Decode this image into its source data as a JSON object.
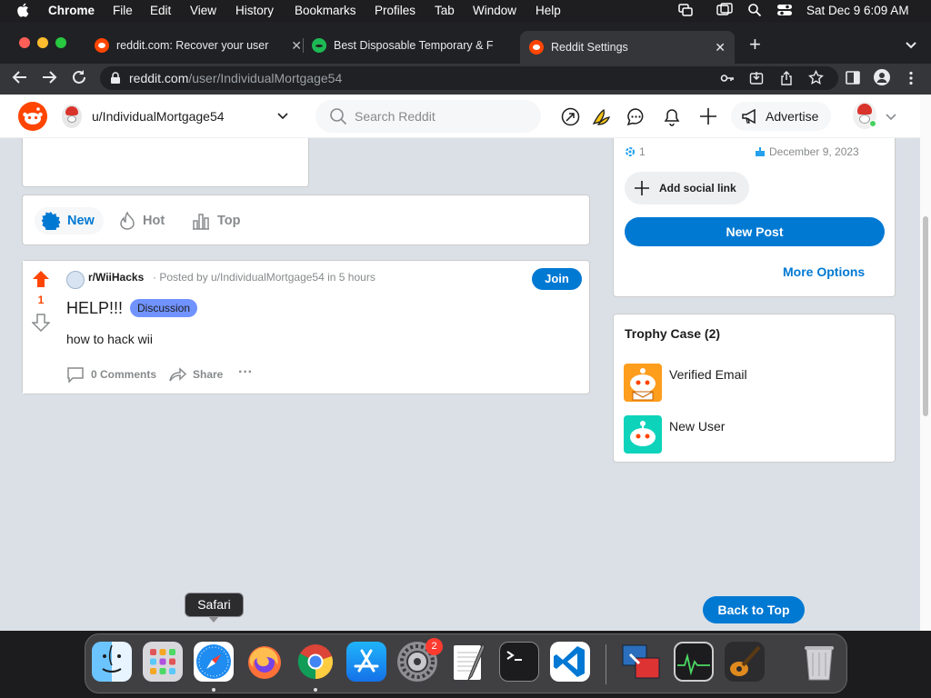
{
  "menubar": {
    "app": "Chrome",
    "items": [
      "File",
      "Edit",
      "View",
      "History",
      "Bookmarks",
      "Profiles",
      "Tab",
      "Window",
      "Help"
    ],
    "datetime": "Sat Dec 9  6:09 AM"
  },
  "tabs": [
    {
      "title": "reddit.com: Recover your user",
      "active": false
    },
    {
      "title": "Best Disposable Temporary & F",
      "active": false
    },
    {
      "title": "Reddit Settings",
      "active": true
    }
  ],
  "address": {
    "domain": "reddit.com",
    "path": "/user/IndividualMortgage54"
  },
  "reddit_header": {
    "community": "u/IndividualMortgage54",
    "search_placeholder": "Search Reddit",
    "advertise": "Advertise"
  },
  "sort_bar": {
    "new": "New",
    "hot": "Hot",
    "top": "Top"
  },
  "post": {
    "votes": "1",
    "subreddit": "r/WiiHacks",
    "posted_by": "· Posted by u/IndividualMortgage54 in 5 hours",
    "join": "Join",
    "title": "HELP!!!",
    "flair": "Discussion",
    "body": "how to hack wii",
    "comments": "0 Comments",
    "share": "Share",
    "more": "···"
  },
  "profile_card": {
    "karma": "1",
    "cake_day": "December 9, 2023",
    "add_social": "Add social link",
    "new_post": "New Post",
    "more_options": "More Options"
  },
  "trophy_case": {
    "title": "Trophy Case (2)",
    "items": [
      {
        "name": "Verified Email"
      },
      {
        "name": "New User"
      }
    ]
  },
  "back_to_top": "Back to Top",
  "dock": {
    "tooltip": "Safari",
    "settings_badge": "2",
    "icons": [
      "finder-icon",
      "launchpad-icon",
      "safari-icon",
      "firefox-icon",
      "chrome-icon",
      "app-store-icon",
      "system-settings-icon",
      "textedit-icon",
      "terminal-icon",
      "vscode-icon",
      "remote-desktop-icon",
      "activity-monitor-icon",
      "garageband-icon",
      "trash-icon"
    ]
  },
  "colors": {
    "reddit_orange": "#ff4500",
    "reddit_blue": "#0079d3",
    "flair": "#7193ff",
    "page_bg": "#dae0e6"
  }
}
